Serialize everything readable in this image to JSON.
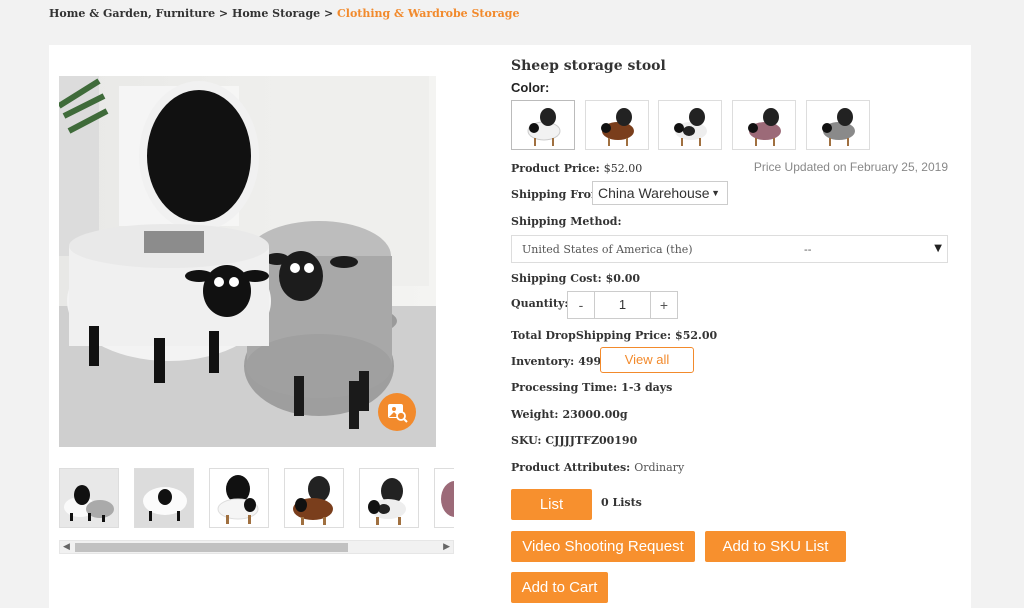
{
  "breadcrumb": {
    "path": "Home & Garden, Furniture > Home Storage > ",
    "current": "Clothing & Wardrobe Storage"
  },
  "product": {
    "title": "Sheep storage stool",
    "color_label": "Color:",
    "price_label": "Product Price:",
    "price_value": "$52.00",
    "price_updated": "Price Updated on February 25, 2019",
    "shipping_from_label": "Shipping From:",
    "shipping_from_value": "China Warehouse",
    "shipping_method_label": "Shipping Method:",
    "shipping_method_value": "United States of America (the)",
    "shipping_method_dash": "--",
    "shipping_cost_label": "Shipping Cost:",
    "shipping_cost_value": "$0.00",
    "quantity_label": "Quantity:",
    "quantity_value": "1",
    "quantity_minus": "-",
    "quantity_plus": "+",
    "total_label": "Total DropShipping Price:",
    "total_value": "$52.00",
    "inventory_label": "Inventory:",
    "inventory_value": "49999",
    "view_all": "View all",
    "processing_label": "Processing Time:",
    "processing_value": "1-3 days",
    "weight_label": "Weight:",
    "weight_value": "23000.00g",
    "sku_label": "SKU:",
    "sku_value": "CJJJJTFZ00190",
    "attributes_label": "Product Attributes:",
    "attributes_value": "Ordinary"
  },
  "swatches": [
    {
      "name": "white",
      "color": "#f2f2f2"
    },
    {
      "name": "brown",
      "color": "#7a3e1c"
    },
    {
      "name": "black-white",
      "color": "#eeeeee"
    },
    {
      "name": "pink",
      "color": "#9c6a78"
    },
    {
      "name": "gray",
      "color": "#8a8a8a"
    }
  ],
  "actions": {
    "list": "List",
    "lists_count": "0 Lists",
    "video_request": "Video Shooting Request",
    "add_sku": "Add to SKU List",
    "add_cart": "Add to Cart"
  },
  "colors": {
    "accent": "#f7902e"
  }
}
